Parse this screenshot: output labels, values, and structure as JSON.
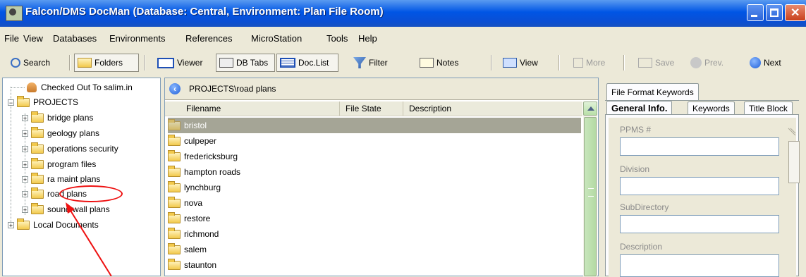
{
  "window": {
    "title": "Falcon/DMS DocMan (Database: Central, Environment: Plan File Room)"
  },
  "menu": [
    "File",
    "View",
    "Databases",
    "Environments",
    "References",
    "MicroStation",
    "Tools",
    "Help"
  ],
  "toolbar": {
    "search": "Search",
    "folders": "Folders",
    "viewer": "Viewer",
    "db_tabs": "DB Tabs",
    "doc_list": "Doc.List",
    "filter": "Filter",
    "notes": "Notes",
    "view": "View",
    "more": "More",
    "save": "Save",
    "prev": "Prev.",
    "next": "Next"
  },
  "tree": {
    "checked_out": "Checked Out To salim.in",
    "projects": "PROJECTS",
    "children": [
      "bridge plans",
      "geology plans",
      "operations security",
      "program files",
      "ra maint plans",
      "road plans",
      "sound wall plans"
    ],
    "local": "Local Documents"
  },
  "middle": {
    "path": "PROJECTS\\road plans",
    "columns": [
      "Filename",
      "File State",
      "Description"
    ],
    "rows": [
      "bristol",
      "culpeper",
      "fredericksburg",
      "hampton roads",
      "lynchburg",
      "nova",
      "restore",
      "richmond",
      "salem",
      "staunton"
    ]
  },
  "right": {
    "top_tab": "File Format Keywords",
    "tabs": [
      "General Info.",
      "Keywords",
      "Title Block"
    ],
    "fields": [
      "PPMS #",
      "Division",
      "SubDirectory",
      "Description"
    ]
  }
}
